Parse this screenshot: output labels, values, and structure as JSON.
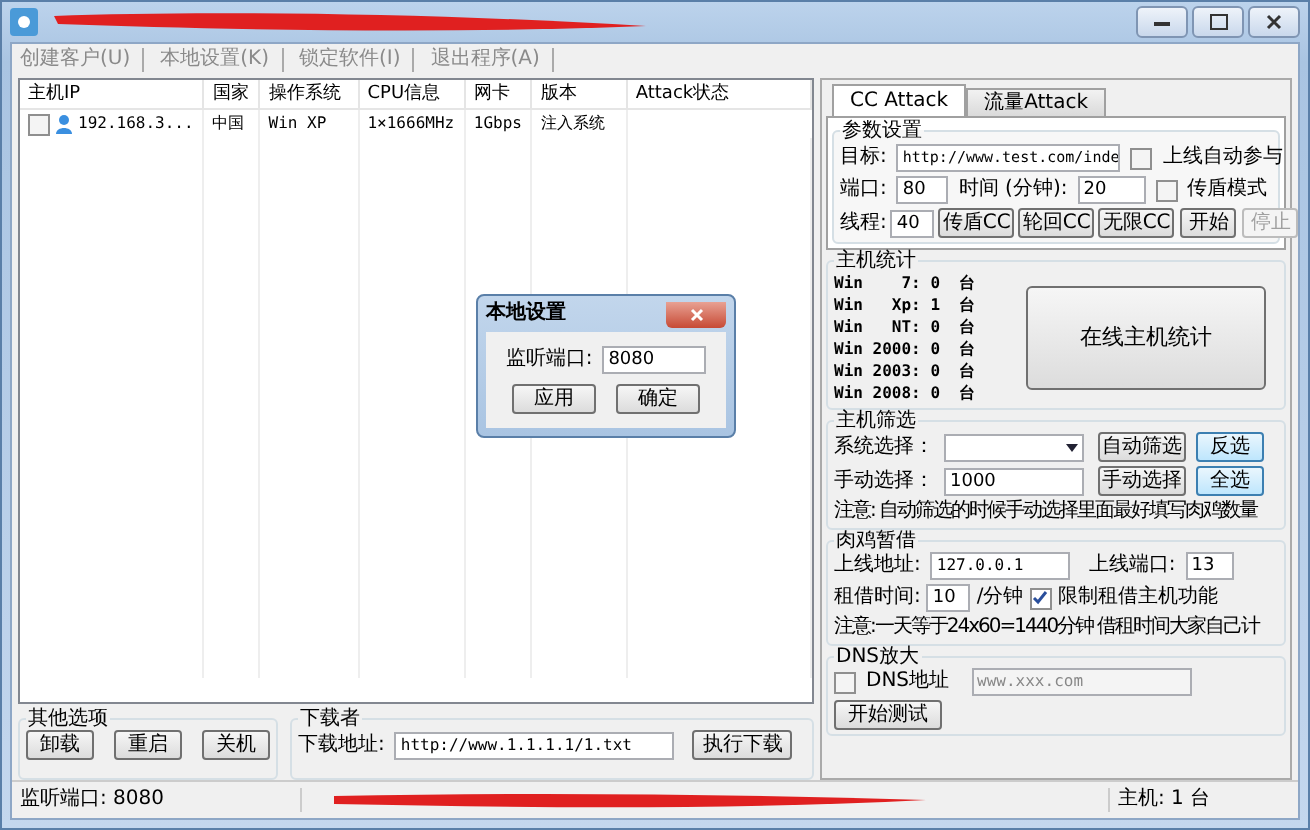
{
  "menu": [
    "创建客户(U)",
    "本地设置(K)",
    "锁定软件(I)",
    "退出程序(A)"
  ],
  "hosts": {
    "columns": [
      "主机IP",
      "国家",
      "操作系统",
      "CPU信息",
      "网卡",
      "版本",
      "Attack状态"
    ],
    "rows": [
      {
        "checked": false,
        "cells": [
          "192.168.3...",
          "中国",
          "Win XP",
          "1×1666MHz",
          "1Gbps",
          "注入系统"
        ]
      }
    ]
  },
  "other_options": {
    "title": "其他选项",
    "buttons": [
      "卸载",
      "重启",
      "关机"
    ]
  },
  "downloader": {
    "title": "下载者",
    "label": "下载地址:",
    "value": "http://www.1.1.1.1/1.txt",
    "button": "执行下载"
  },
  "status_bar": {
    "port": "监听端口: 8080",
    "hosts": "主机: 1 台"
  },
  "dialog": {
    "title": "本地设置",
    "label": "监听端口:",
    "value": "8080",
    "buttons": [
      "应用",
      "确定"
    ]
  },
  "attack_tabs": [
    {
      "label": "CC Attack",
      "selected": true
    },
    {
      "label": "流量Attack",
      "selected": false
    }
  ],
  "params": {
    "title": "参数设置",
    "target_label": "目标:",
    "target": "http://www.test.com/inde",
    "auto_join": {
      "label": "上线自动参与",
      "checked": false
    },
    "port_label": "端口:",
    "port": "80",
    "time_label": "时间 (分钟):",
    "time": "20",
    "shield": {
      "label": "传盾模式",
      "checked": false
    },
    "threads_label": "线程:",
    "threads": "40",
    "buttons": [
      {
        "label": "传盾CC",
        "disabled": false
      },
      {
        "label": "轮回CC",
        "disabled": false
      },
      {
        "label": "无限CC",
        "disabled": false
      },
      {
        "label": "开始",
        "disabled": false
      },
      {
        "label": "停止",
        "disabled": true
      }
    ]
  },
  "stats": {
    "title": "主机统计",
    "rows": [
      {
        "name": "Win    7:",
        "count": "0",
        "unit": "台"
      },
      {
        "name": "Win   Xp:",
        "count": "1",
        "unit": "台"
      },
      {
        "name": "Win   NT:",
        "count": "0",
        "unit": "台"
      },
      {
        "name": "Win 2000:",
        "count": "0",
        "unit": "台"
      },
      {
        "name": "Win 2003:",
        "count": "0",
        "unit": "台"
      },
      {
        "name": "Win 2008:",
        "count": "0",
        "unit": "台"
      }
    ],
    "button": "在线主机统计"
  },
  "filter": {
    "title": "主机筛选",
    "system_label": "系统选择：",
    "manual_label": "手动选择：",
    "manual": "1000",
    "buttons": [
      "自动筛选",
      "反选",
      "手动选择",
      "全选"
    ],
    "note": "注意: 自动筛选的时候手动选择里面最好填写肉鸡数量"
  },
  "rent": {
    "title": "肉鸡暂借",
    "addr_label": "上线地址:",
    "addr": "127.0.0.1",
    "port_label": "上线端口:",
    "port": "13",
    "time_label": "租借时间:",
    "time": "10",
    "unit": "/分钟",
    "limit": {
      "label": "限制租借主机功能",
      "checked": true
    },
    "note": "注意:一天等于24x60=1440分钟   借租时间大家自己计"
  },
  "dns": {
    "title": "DNS放大",
    "checkbox": {
      "label": "DNS地址",
      "checked": false
    },
    "placeholder": "www.xxx.com",
    "button": "开始测试"
  }
}
